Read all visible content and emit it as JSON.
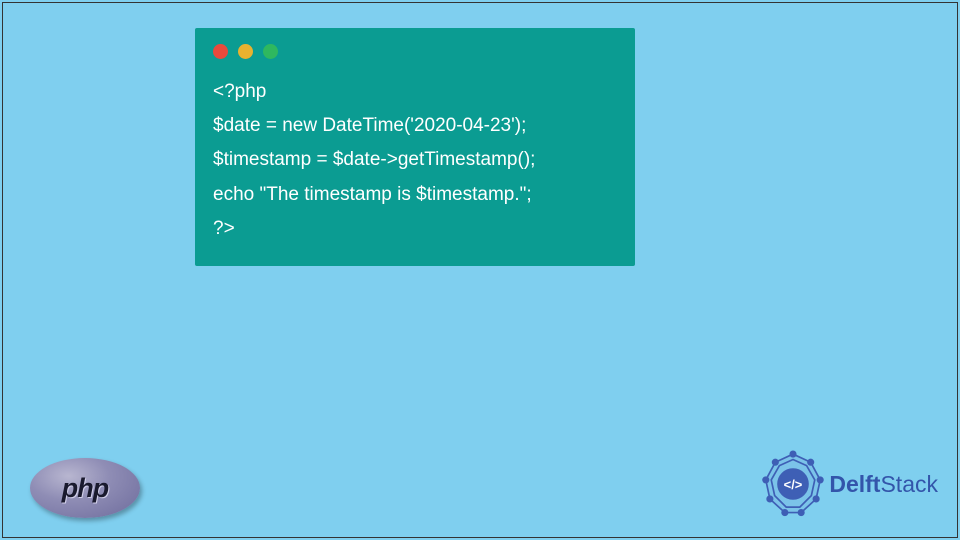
{
  "code": {
    "line1": "<?php",
    "line2": "$date = new DateTime('2020-04-23');",
    "line3": "$timestamp = $date->getTimestamp();",
    "line4": "echo \"The timestamp is $timestamp.\";",
    "line5": "?>"
  },
  "php_logo": {
    "text": "php"
  },
  "delft_logo": {
    "brand_bold": "Delft",
    "brand_rest": "Stack",
    "center_symbol": "</>"
  }
}
